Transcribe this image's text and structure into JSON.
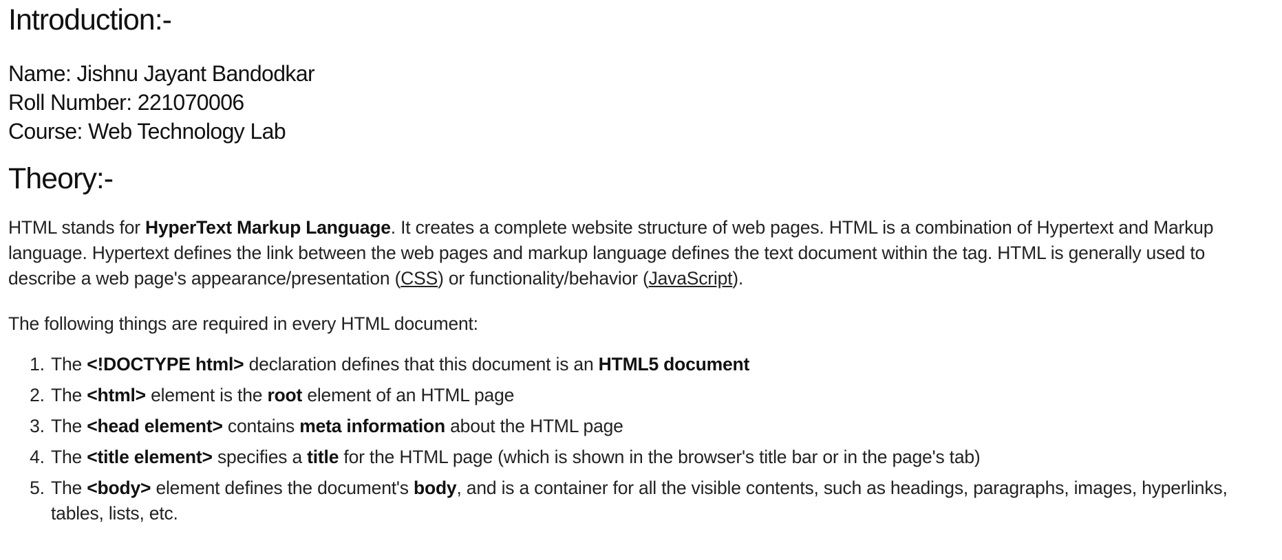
{
  "intro": {
    "heading": "Introduction:-",
    "name": "Name: Jishnu Jayant Bandodkar",
    "roll": "Roll Number: 221070006",
    "course": "Course: Web Technology Lab"
  },
  "theory": {
    "heading": "Theory:-",
    "para1": {
      "t1": "HTML stands for ",
      "b1": "HyperText Markup Language",
      "t2": ". It creates a complete website structure of web pages. HTML is a combination of Hypertext and Markup language. Hypertext defines the link between the web pages and markup language defines the text document within the tag. HTML is generally used to describe a web page's appearance/presentation (",
      "link_css": "CSS",
      "t3": ") or functionality/behavior (",
      "link_js": "JavaScript",
      "t4": ")."
    },
    "para2": "The following things are required in every HTML document:",
    "list": [
      {
        "t1": "The ",
        "b1": "<!DOCTYPE html>",
        "t2": " declaration defines that this document is an ",
        "b2": "HTML5 document",
        "t3": ""
      },
      {
        "t1": "The ",
        "b1": "<html>",
        "t2": " element is the ",
        "b2": "root",
        "t3": " element of an HTML page"
      },
      {
        "t1": "The ",
        "b1": "<head element>",
        "t2": " contains ",
        "b2": "meta information",
        "t3": " about the HTML page"
      },
      {
        "t1": "The ",
        "b1": "<title element>",
        "t2": " specifies a ",
        "b2": "title",
        "t3": " for the HTML page (which is shown in the browser's title bar or in the page's tab)"
      },
      {
        "t1": "The ",
        "b1": "<body>",
        "t2": " element defines the document's ",
        "b2": "body",
        "t3": ", and is a container for all the visible contents, such as headings, paragraphs, images, hyperlinks, tables, lists, etc."
      }
    ]
  }
}
